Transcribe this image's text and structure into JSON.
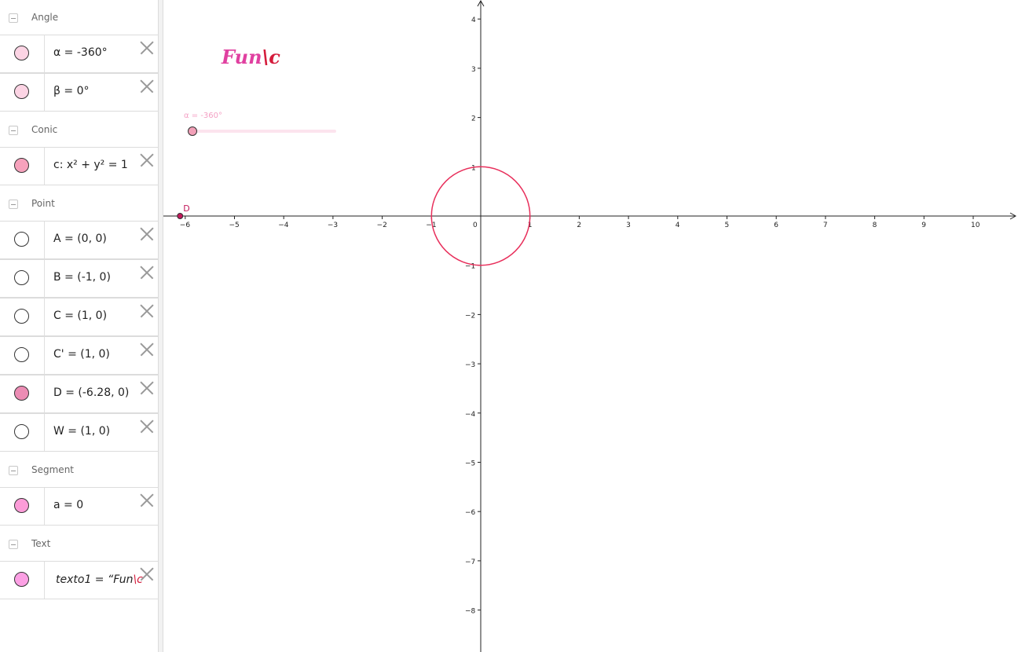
{
  "algebra": {
    "groups": [
      {
        "label": "Angle",
        "items": [
          {
            "expr": "α = -360°",
            "marble_color": "#fcd4e4"
          },
          {
            "expr": "β = 0°",
            "marble_color": "#fcd4e4"
          }
        ]
      },
      {
        "label": "Conic",
        "items": [
          {
            "expr": "c: x² + y² = 1",
            "marble_color": "#f6a2bc"
          }
        ]
      },
      {
        "label": "Point",
        "items": [
          {
            "expr": "A = (0, 0)",
            "marble_color": "#ffffff"
          },
          {
            "expr": "B = (-1, 0)",
            "marble_color": "#ffffff"
          },
          {
            "expr": "C = (1, 0)",
            "marble_color": "#ffffff"
          },
          {
            "expr": "C' = (1, 0)",
            "marble_color": "#ffffff"
          },
          {
            "expr": "D = (-6.28, 0)",
            "marble_color": "#ec8cb4"
          },
          {
            "expr": "W = (1, 0)",
            "marble_color": "#ffffff"
          }
        ]
      },
      {
        "label": "Segment",
        "items": [
          {
            "expr": "a = 0",
            "marble_color": "#fc9cd8"
          }
        ]
      },
      {
        "label": "Text",
        "items": [
          {
            "expr_main": "texto1 = “Fun",
            "expr_accent": "\\c",
            "marble_color": "#fca0e4"
          }
        ]
      }
    ]
  },
  "graphics": {
    "slider_label": "α = -360°",
    "title_main": "Fun",
    "title_accent": "\\c",
    "point_label": "D",
    "x_ticks": [
      "-6",
      "-5",
      "-4",
      "-3",
      "-2",
      "-1",
      "0",
      "1",
      "2",
      "3",
      "4",
      "5",
      "6",
      "7",
      "8",
      "9",
      "10"
    ],
    "y_ticks": [
      "4",
      "3",
      "2",
      "1",
      "-1",
      "-2",
      "-3",
      "-4",
      "-5",
      "-6",
      "-7",
      "-8"
    ],
    "colors": {
      "circle": "#e8305c",
      "point": "#c2185b",
      "title": "#e040a0",
      "title_accent": "#d41c3c",
      "slider": "#f4a0c4"
    }
  }
}
